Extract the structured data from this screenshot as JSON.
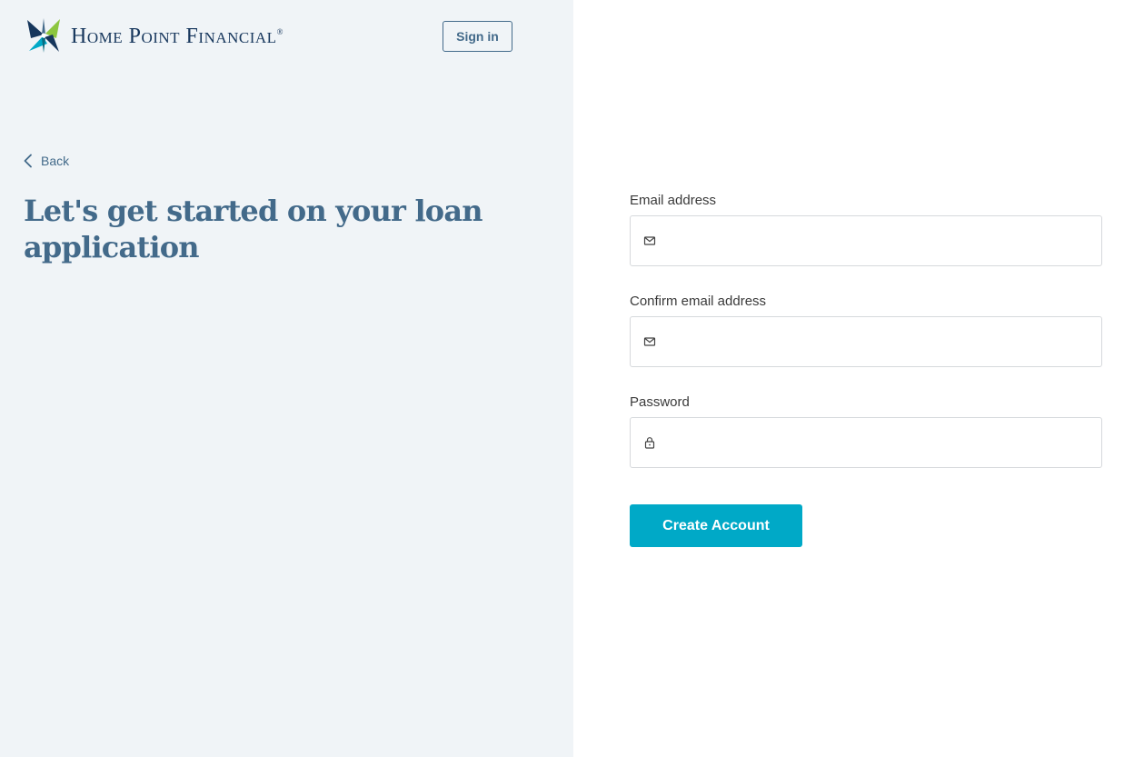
{
  "brand": {
    "name": "Home Point Financial",
    "registered_mark": "®",
    "colors": {
      "navy": "#16365c",
      "slate": "#436a8a",
      "teal": "#00a9c7",
      "green": "#8cc63f"
    }
  },
  "header": {
    "signin_label": "Sign in"
  },
  "nav": {
    "back_label": "Back",
    "back_icon": "chevron-left-icon"
  },
  "hero": {
    "headline": "Let's get started on your loan application"
  },
  "form": {
    "email": {
      "label": "Email address",
      "value": "",
      "icon": "mail-icon"
    },
    "confirm_email": {
      "label": "Confirm email address",
      "value": "",
      "icon": "mail-icon"
    },
    "password": {
      "label": "Password",
      "value": "",
      "icon": "lock-icon"
    },
    "submit_label": "Create Account"
  }
}
